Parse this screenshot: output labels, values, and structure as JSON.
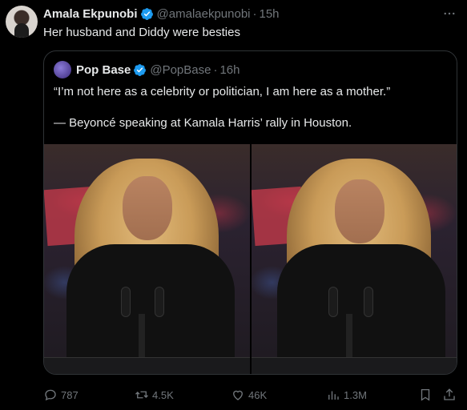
{
  "post": {
    "author_name": "Amala Ekpunobi",
    "author_handle": "@amalaekpunobi",
    "separator": "·",
    "time": "15h",
    "text": "Her husband and Diddy were besties",
    "more_icon": "more-horizontal-icon"
  },
  "quote": {
    "author_name": "Pop Base",
    "author_handle": "@PopBase",
    "separator": "·",
    "time": "16h",
    "line1": "“I’m not here as a celebrity or politician, I am here as a mother.”",
    "line2": "— Beyoncé speaking at Kamala Harris’ rally in Houston."
  },
  "actions": {
    "replies": "787",
    "reposts": "4.5K",
    "likes": "46K",
    "views": "1.3M"
  },
  "colors": {
    "background": "#000000",
    "text": "#e7e9ea",
    "muted": "#71767b",
    "verified": "#1d9bf0",
    "border": "#2f3336"
  }
}
